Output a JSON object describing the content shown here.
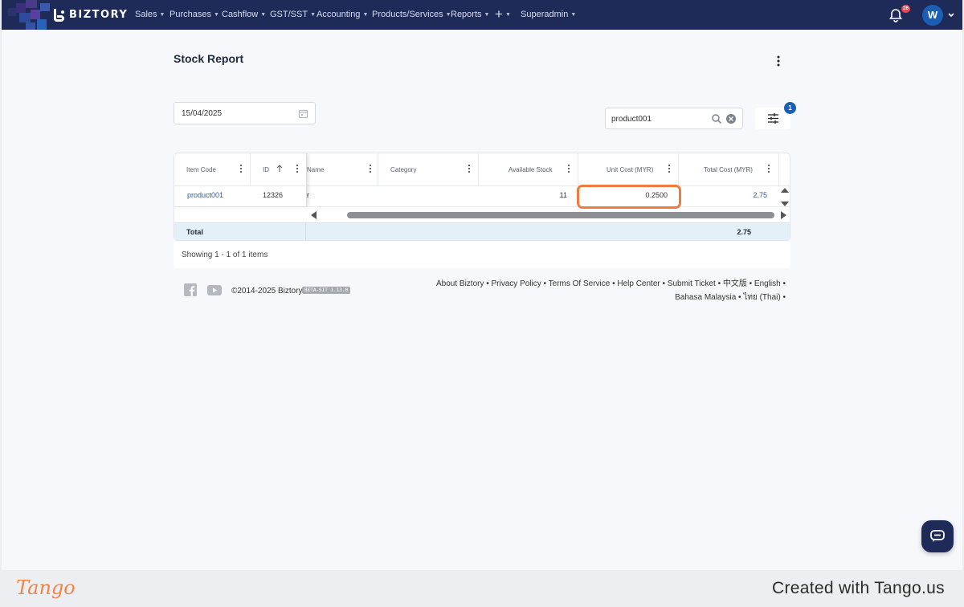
{
  "app": {
    "brand": "BIZTORY"
  },
  "nav": {
    "items": [
      {
        "label": "Sales"
      },
      {
        "label": "Purchases"
      },
      {
        "label": "Cashflow"
      },
      {
        "label": "GST/SST"
      },
      {
        "label": "Accounting"
      },
      {
        "label": "Products/Services"
      },
      {
        "label": "Reports"
      },
      {
        "label": "Superadmin"
      }
    ],
    "plus_label": "+",
    "notification_count": "26",
    "avatar_initial": "W"
  },
  "page": {
    "title": "Stock Report"
  },
  "filters": {
    "date_value": "15/04/2025",
    "search_value": "product001",
    "active_filter_count": "1"
  },
  "grid": {
    "columns": [
      {
        "label": "Item Code"
      },
      {
        "label": "ID"
      },
      {
        "label": "Name"
      },
      {
        "label": "Category"
      },
      {
        "label": "Available Stock"
      },
      {
        "label": "Unit Cost (MYR)"
      },
      {
        "label": "Total Cost (MYR)"
      }
    ],
    "rows": [
      {
        "item_code": "product001",
        "id": "12326",
        "name": "r",
        "category": "",
        "available_stock": "11",
        "unit_cost": "0.2500",
        "total_cost": "2.75"
      }
    ],
    "total": {
      "label": "Total",
      "total_cost": "2.75"
    },
    "pager_text": "Showing 1 - 1 of 1 items"
  },
  "footer": {
    "copyright": "©2014-2025 Biztory",
    "version_badge": "BETA-SIT 1.13.0",
    "links_line1": "About Biztory • Privacy Policy • Terms Of Service • Help Center • Submit Ticket • 中文版 • English •",
    "links_line2": "Bahasa Malaysia • ไทย (Thai) •"
  },
  "tango": {
    "logo": "Tango",
    "credit": "Created with Tango.us"
  },
  "colors": {
    "nav_bg": "#1e2a57",
    "accent": "#1a5fb4",
    "highlight": "#f07a3f",
    "total_row": "#e3f0f8"
  }
}
